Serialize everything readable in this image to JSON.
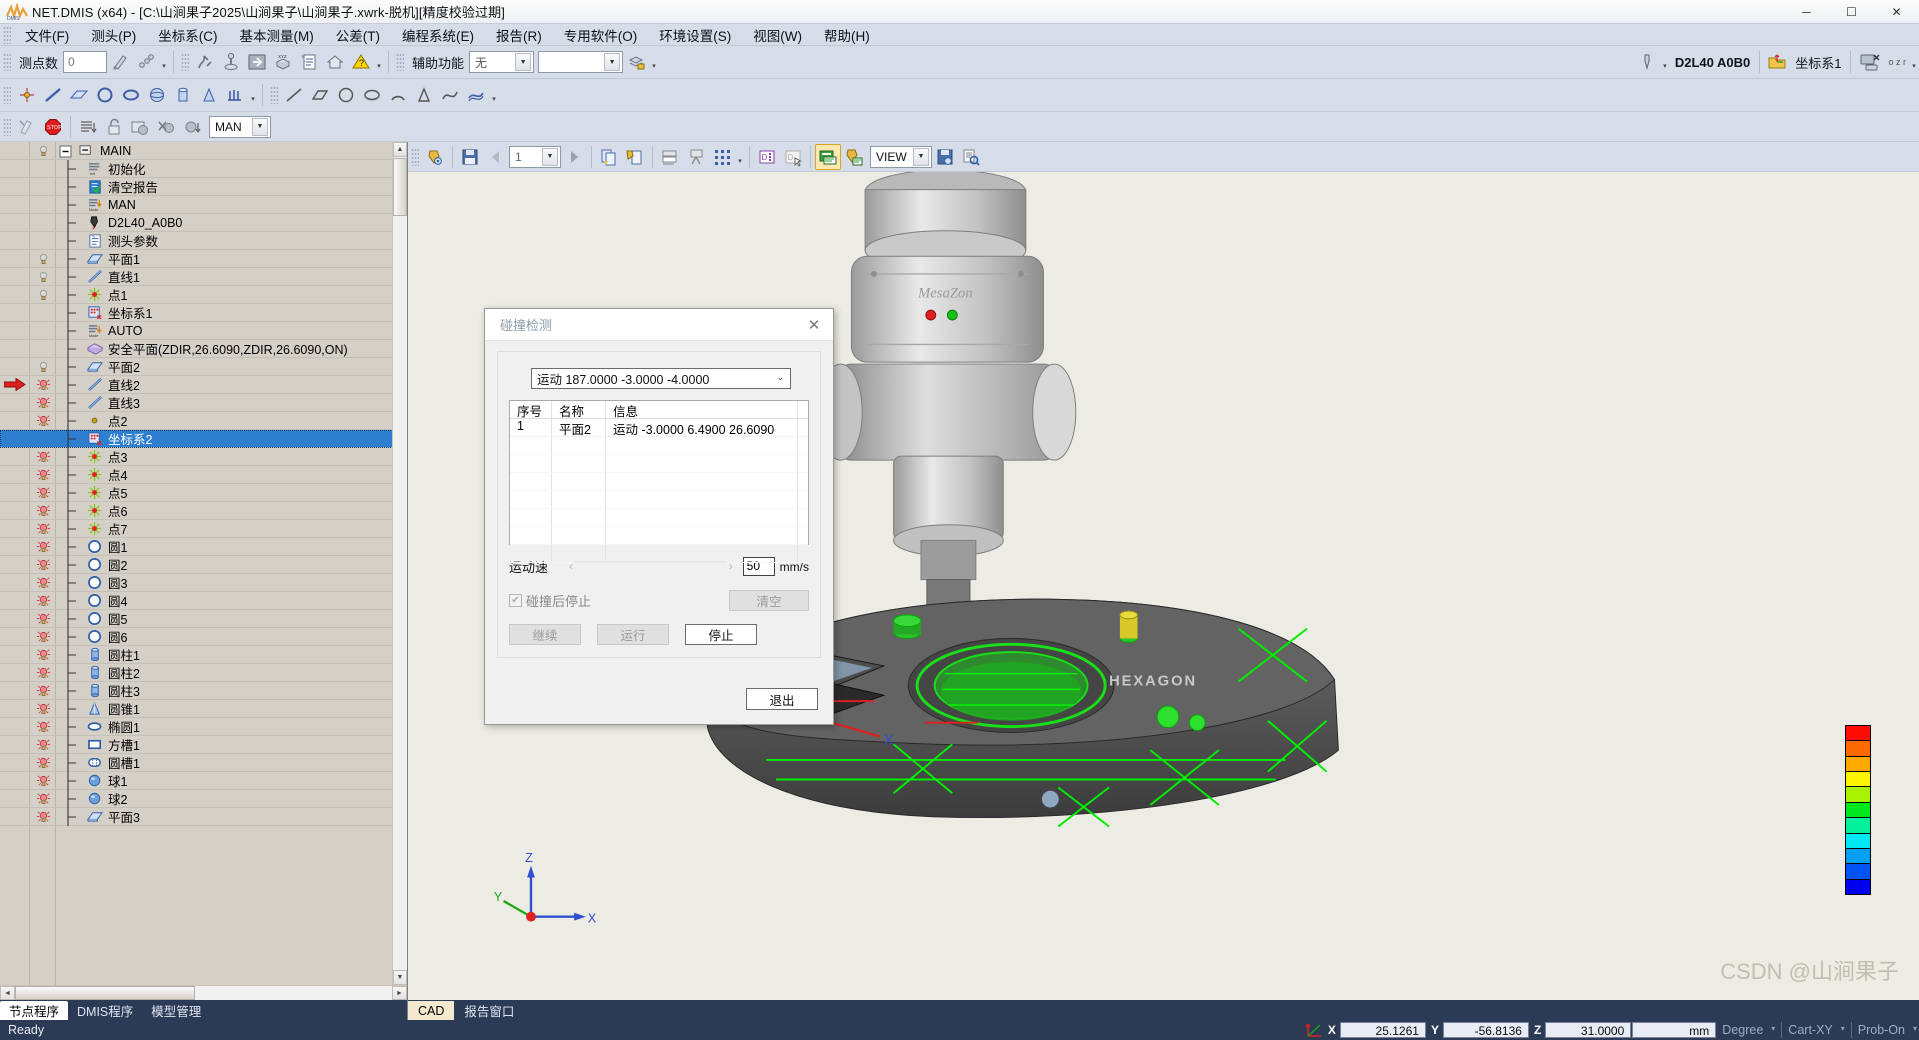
{
  "window": {
    "title": "NET.DMIS (x64) - [C:\\山涧果子2025\\山涧果子\\山涧果子.xwrk-脱机][精度校验过期]",
    "minimize": "─",
    "maximize": "☐",
    "close": "✕"
  },
  "menubar": {
    "items": [
      {
        "label": "文件(F)"
      },
      {
        "label": "测头(P)"
      },
      {
        "label": "坐标系(C)"
      },
      {
        "label": "基本测量(M)"
      },
      {
        "label": "公差(T)"
      },
      {
        "label": "编程系统(E)"
      },
      {
        "label": "报告(R)"
      },
      {
        "label": "专用软件(O)"
      },
      {
        "label": "环境设置(S)"
      },
      {
        "label": "视图(W)"
      },
      {
        "label": "帮助(H)"
      }
    ]
  },
  "toolbar1": {
    "point_count_label": "测点数",
    "point_count_value": "0",
    "aux_label": "辅助功能",
    "aux_value": "无",
    "aux_value2": "",
    "probe_name": "D2L40  A0B0",
    "coordsys_name": "坐标系1"
  },
  "toolbar3": {
    "mode_value": "MAN"
  },
  "cadtoolbar": {
    "step_value": "1",
    "view_value": "VIEW"
  },
  "tree": {
    "items": [
      {
        "label": "MAIN",
        "icon": "folder-root-icon",
        "depth": 0,
        "bulb": "off",
        "selected": false,
        "marker": false
      },
      {
        "label": "初始化",
        "icon": "init-icon",
        "depth": 1,
        "bulb": "none",
        "selected": false,
        "marker": false
      },
      {
        "label": "清空报告",
        "icon": "clear-report-icon",
        "depth": 1,
        "bulb": "none",
        "selected": false,
        "marker": false
      },
      {
        "label": "MAN",
        "icon": "mode-icon",
        "depth": 1,
        "bulb": "none",
        "selected": false,
        "marker": false
      },
      {
        "label": "D2L40_A0B0",
        "icon": "probe-icon",
        "depth": 1,
        "bulb": "none",
        "selected": false,
        "marker": false
      },
      {
        "label": "测头参数",
        "icon": "probe-param-icon",
        "depth": 1,
        "bulb": "none",
        "selected": false,
        "marker": false
      },
      {
        "label": "平面1",
        "icon": "plane-icon",
        "depth": 1,
        "bulb": "off",
        "selected": false,
        "marker": false
      },
      {
        "label": "直线1",
        "icon": "line-icon",
        "depth": 1,
        "bulb": "off",
        "selected": false,
        "marker": false
      },
      {
        "label": "点1",
        "icon": "point-star-icon",
        "depth": 1,
        "bulb": "off",
        "selected": false,
        "marker": false
      },
      {
        "label": "坐标系1",
        "icon": "coordsys-icon",
        "depth": 1,
        "bulb": "none",
        "selected": false,
        "marker": false
      },
      {
        "label": "AUTO",
        "icon": "mode-icon",
        "depth": 1,
        "bulb": "none",
        "selected": false,
        "marker": false
      },
      {
        "label": "安全平面(ZDIR,26.6090,ZDIR,26.6090,ON)",
        "icon": "safety-plane-icon",
        "depth": 1,
        "bulb": "none",
        "selected": false,
        "marker": false
      },
      {
        "label": "平面2",
        "icon": "plane-icon",
        "depth": 1,
        "bulb": "off",
        "selected": false,
        "marker": false
      },
      {
        "label": "直线2",
        "icon": "line-icon",
        "depth": 1,
        "bulb": "on",
        "selected": false,
        "marker": true
      },
      {
        "label": "直线3",
        "icon": "line-icon",
        "depth": 1,
        "bulb": "on",
        "selected": false,
        "marker": false
      },
      {
        "label": "点2",
        "icon": "point-dot-icon",
        "depth": 1,
        "bulb": "on",
        "selected": false,
        "marker": false
      },
      {
        "label": "坐标系2",
        "icon": "coordsys-icon",
        "depth": 1,
        "bulb": "none",
        "selected": true,
        "marker": false
      },
      {
        "label": "点3",
        "icon": "point-star-icon",
        "depth": 1,
        "bulb": "on",
        "selected": false,
        "marker": false
      },
      {
        "label": "点4",
        "icon": "point-star-icon",
        "depth": 1,
        "bulb": "on",
        "selected": false,
        "marker": false
      },
      {
        "label": "点5",
        "icon": "point-star-icon",
        "depth": 1,
        "bulb": "on",
        "selected": false,
        "marker": false
      },
      {
        "label": "点6",
        "icon": "point-star-icon",
        "depth": 1,
        "bulb": "on",
        "selected": false,
        "marker": false
      },
      {
        "label": "点7",
        "icon": "point-star-icon",
        "depth": 1,
        "bulb": "on",
        "selected": false,
        "marker": false
      },
      {
        "label": "圆1",
        "icon": "circle-icon",
        "depth": 1,
        "bulb": "on",
        "selected": false,
        "marker": false
      },
      {
        "label": "圆2",
        "icon": "circle-icon",
        "depth": 1,
        "bulb": "on",
        "selected": false,
        "marker": false
      },
      {
        "label": "圆3",
        "icon": "circle-icon",
        "depth": 1,
        "bulb": "on",
        "selected": false,
        "marker": false
      },
      {
        "label": "圆4",
        "icon": "circle-icon",
        "depth": 1,
        "bulb": "on",
        "selected": false,
        "marker": false
      },
      {
        "label": "圆5",
        "icon": "circle-icon",
        "depth": 1,
        "bulb": "on",
        "selected": false,
        "marker": false
      },
      {
        "label": "圆6",
        "icon": "circle-icon",
        "depth": 1,
        "bulb": "on",
        "selected": false,
        "marker": false
      },
      {
        "label": "圆柱1",
        "icon": "cylinder-icon",
        "depth": 1,
        "bulb": "on",
        "selected": false,
        "marker": false
      },
      {
        "label": "圆柱2",
        "icon": "cylinder-icon",
        "depth": 1,
        "bulb": "on",
        "selected": false,
        "marker": false
      },
      {
        "label": "圆柱3",
        "icon": "cylinder-icon",
        "depth": 1,
        "bulb": "on",
        "selected": false,
        "marker": false
      },
      {
        "label": "圆锥1",
        "icon": "cone-icon",
        "depth": 1,
        "bulb": "on",
        "selected": false,
        "marker": false
      },
      {
        "label": "椭圆1",
        "icon": "ellipse-icon",
        "depth": 1,
        "bulb": "on",
        "selected": false,
        "marker": false
      },
      {
        "label": "方槽1",
        "icon": "square-slot-icon",
        "depth": 1,
        "bulb": "on",
        "selected": false,
        "marker": false
      },
      {
        "label": "圆槽1",
        "icon": "round-slot-icon",
        "depth": 1,
        "bulb": "on",
        "selected": false,
        "marker": false
      },
      {
        "label": "球1",
        "icon": "sphere-icon",
        "depth": 1,
        "bulb": "on",
        "selected": false,
        "marker": false
      },
      {
        "label": "球2",
        "icon": "sphere-icon",
        "depth": 1,
        "bulb": "on",
        "selected": false,
        "marker": false
      },
      {
        "label": "平面3",
        "icon": "plane-icon",
        "depth": 1,
        "bulb": "on",
        "selected": false,
        "marker": false
      }
    ]
  },
  "left_tabs": [
    {
      "label": "节点程序",
      "active": true
    },
    {
      "label": "DMIS程序",
      "active": false
    },
    {
      "label": "模型管理",
      "active": false
    }
  ],
  "cad_tabs": [
    {
      "label": "CAD",
      "active": true
    },
    {
      "label": "报告窗口",
      "active": false
    }
  ],
  "dialog": {
    "title": "碰撞检测",
    "close_label": "✕",
    "motion_select": "运动 187.0000 -3.0000 -4.0000",
    "table": {
      "headers": [
        "序号",
        "名称",
        "信息"
      ],
      "rows": [
        {
          "seq": "1",
          "name": "平面2",
          "info": "运动 -3.0000 6.4900 26.6090"
        }
      ]
    },
    "speed_label": "运动速",
    "speed_value": "50",
    "speed_unit": "mm/s",
    "stop_on_collision_label": "碰撞后停止",
    "stop_on_collision_checked": true,
    "clear_label": "清空",
    "continue_label": "继续",
    "run_label": "运行",
    "stop_label": "停止",
    "exit_label": "退出"
  },
  "statusbar": {
    "ready": "Ready",
    "x_label": "X",
    "x_value": "25.1261",
    "y_label": "Y",
    "y_value": "-56.8136",
    "z_label": "Z",
    "z_value": "31.0000",
    "unit": "mm",
    "angle_unit": "Degree",
    "coord_mode": "Cart-XY",
    "probe_state": "Prob-On"
  },
  "canvas": {
    "machine_label": "MesaZon",
    "part_brand": "HEXAGON",
    "axis_x": "X",
    "axis_y": "Y",
    "axis_z": "Z",
    "triad_x": "X",
    "triad_y": "Y",
    "triad_z": "Z",
    "watermark": "CSDN @山涧果子",
    "legend_colors": [
      "#ff0c00",
      "#ff6a00",
      "#ffa800",
      "#fff400",
      "#a8f400",
      "#00e81c",
      "#00f09c",
      "#00e8f4",
      "#00a0f4",
      "#0054f4",
      "#0000f0"
    ]
  }
}
